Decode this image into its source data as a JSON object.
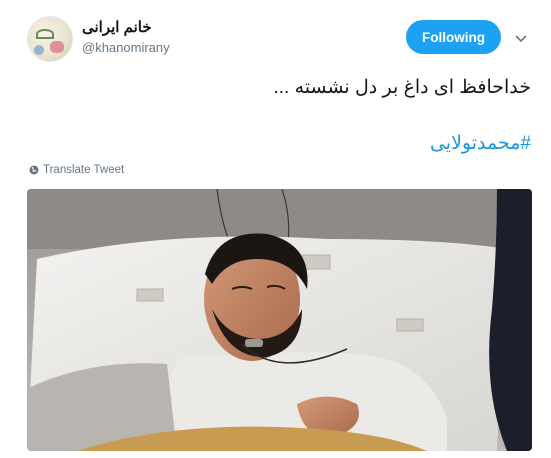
{
  "user": {
    "display_name": "خانم ایرانی",
    "handle": "@khanomirany",
    "avatar_icon": "avatar-image"
  },
  "follow_button": {
    "label": "Following",
    "color": "#1da1f2"
  },
  "menu": {
    "icon": "chevron-down-icon"
  },
  "tweet": {
    "text": "خداحافظ ای داغ بر دل نشسته ...",
    "hashtag": "#محمدتولایی",
    "hashtag_color": "#1b95e0"
  },
  "translate": {
    "label": "Translate Tweet",
    "icon": "globe-icon"
  },
  "media": {
    "type": "photo",
    "description_icon": "hospital-photo"
  }
}
